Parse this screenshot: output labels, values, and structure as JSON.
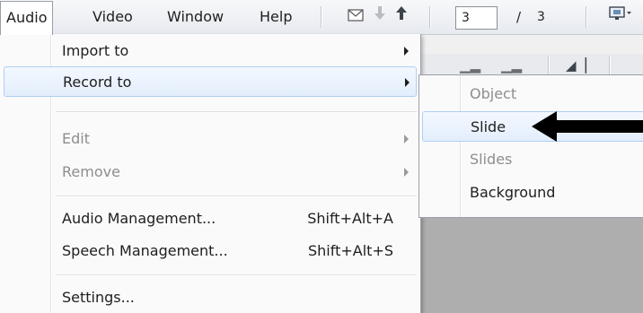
{
  "menubar": {
    "items": [
      {
        "label": "Audio"
      },
      {
        "label": "Video"
      },
      {
        "label": "Window"
      },
      {
        "label": "Help"
      }
    ],
    "page_current": "3",
    "page_separator": "/",
    "page_total": "3",
    "icons": [
      "mail-icon",
      "arrow-down-icon",
      "arrow-up-icon",
      "preview-icon"
    ]
  },
  "audio_menu": {
    "items": [
      {
        "label": "Import to",
        "shortcut": "",
        "submenu": true,
        "enabled": true
      },
      {
        "label": "Record to",
        "shortcut": "",
        "submenu": true,
        "enabled": true,
        "highlighted": true
      },
      {
        "label": "Edit",
        "shortcut": "",
        "submenu": true,
        "enabled": false
      },
      {
        "label": "Remove",
        "shortcut": "",
        "submenu": true,
        "enabled": false
      },
      {
        "label": "Audio Management...",
        "shortcut": "Shift+Alt+A",
        "enabled": true
      },
      {
        "label": "Speech Management...",
        "shortcut": "Shift+Alt+S",
        "enabled": true
      },
      {
        "label": "Settings...",
        "shortcut": "",
        "enabled": true
      }
    ]
  },
  "record_submenu": {
    "items": [
      {
        "label": "Object",
        "enabled": false
      },
      {
        "label": "Slide",
        "enabled": true,
        "highlighted": true
      },
      {
        "label": "Slides",
        "enabled": false
      },
      {
        "label": "Background",
        "enabled": true
      }
    ]
  },
  "colors": {
    "highlight_border": "#aecff7",
    "highlight_fill": "#e3eefc",
    "disabled_text": "#8d8d8d",
    "canvas_gray": "#aeaeae"
  }
}
